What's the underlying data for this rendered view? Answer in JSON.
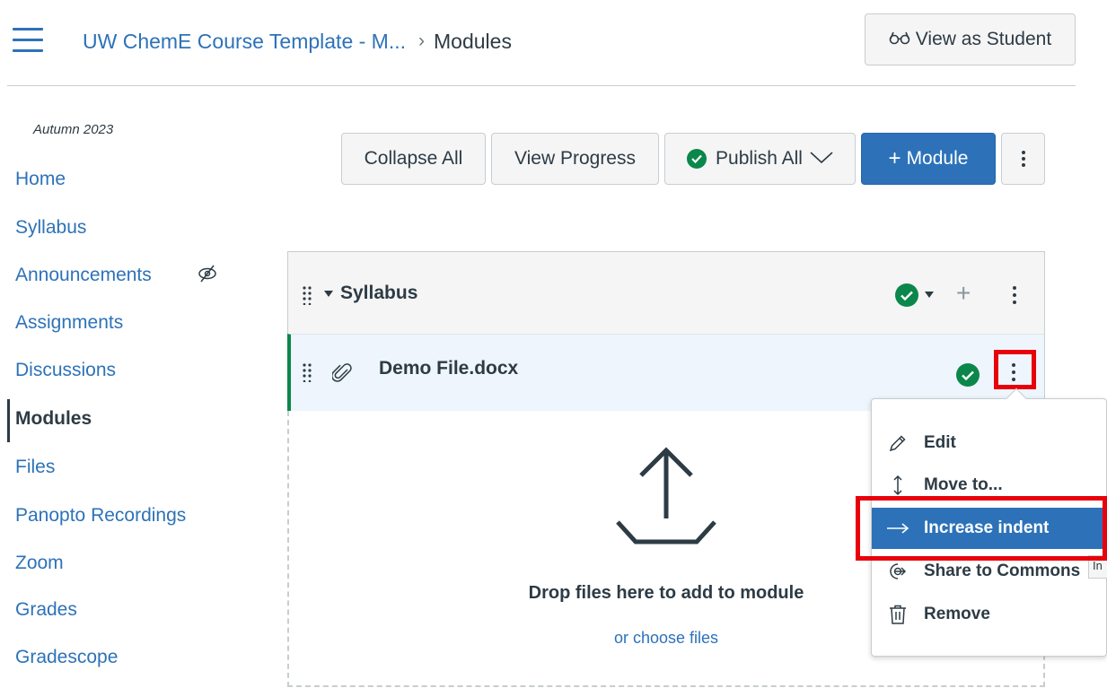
{
  "header": {
    "course_link": "UW ChemE Course Template - M...",
    "breadcrumb_separator": "›",
    "current_page": "Modules",
    "view_as_student": "View as Student",
    "view_as_student_icon": "glasses-icon"
  },
  "sidebar": {
    "term": "Autumn 2023",
    "items": [
      {
        "label": "Home"
      },
      {
        "label": "Syllabus"
      },
      {
        "label": "Announcements",
        "hidden_icon": "eye-off-icon"
      },
      {
        "label": "Assignments"
      },
      {
        "label": "Discussions"
      },
      {
        "label": "Modules",
        "active": true
      },
      {
        "label": "Files"
      },
      {
        "label": "Panopto Recordings"
      },
      {
        "label": "Zoom"
      },
      {
        "label": "Grades"
      },
      {
        "label": "Gradescope"
      }
    ]
  },
  "toolbar": {
    "collapse_all": "Collapse All",
    "view_progress": "View Progress",
    "publish_all": "Publish All",
    "add_module_plus": "+",
    "add_module": "Module"
  },
  "module": {
    "title": "Syllabus",
    "item": {
      "title": "Demo File.docx",
      "icon": "paperclip-icon",
      "published": true
    },
    "dropzone": {
      "text": "Drop files here to add to module",
      "choose": "or choose files"
    }
  },
  "context_menu": {
    "items": [
      {
        "label": "Edit",
        "icon": "pencil-icon"
      },
      {
        "label": "Move to...",
        "icon": "move-arrows-icon"
      },
      {
        "label": "Increase indent",
        "icon": "arrow-right-icon",
        "highlighted": true
      },
      {
        "label": "Share to Commons",
        "icon": "share-icon"
      },
      {
        "label": "Remove",
        "icon": "trash-icon"
      }
    ],
    "tooltip_fragment": "In"
  },
  "colors": {
    "link": "#2d72b8",
    "text": "#2d3b45",
    "published_green": "#0b874b",
    "primary_button": "#2d72b8",
    "annotation_red": "#e8000b"
  }
}
